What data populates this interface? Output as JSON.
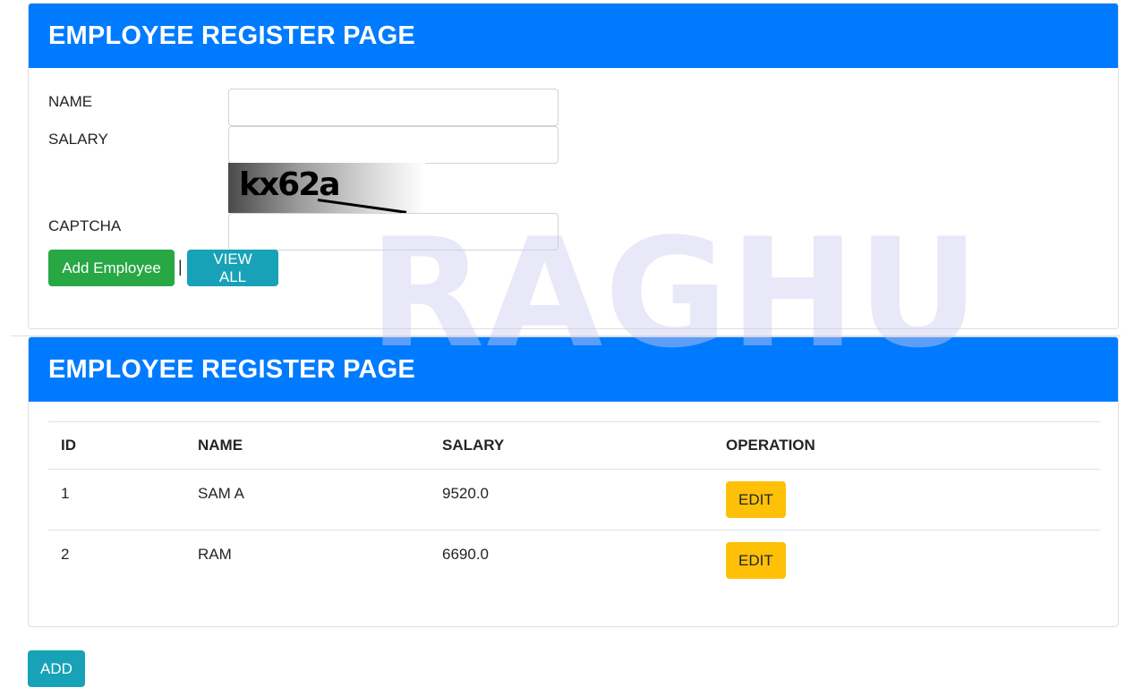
{
  "register_form": {
    "title": "EMPLOYEE REGISTER PAGE",
    "name_label": "NAME",
    "name_value": "",
    "salary_label": "SALARY",
    "salary_value": "",
    "captcha_text": "kx62a",
    "captcha_label": "CAPTCHA",
    "captcha_value": "",
    "add_button": "Add Employee",
    "separator": "|",
    "view_all_button": "VIEW ALL"
  },
  "list": {
    "title": "EMPLOYEE REGISTER PAGE",
    "columns": [
      "ID",
      "NAME",
      "SALARY",
      "OPERATION"
    ],
    "rows": [
      {
        "id": "1",
        "name": "SAM A",
        "salary": "9520.0",
        "action": "EDIT"
      },
      {
        "id": "2",
        "name": "RAM",
        "salary": "6690.0",
        "action": "EDIT"
      }
    ]
  },
  "add_link": "ADD",
  "watermark": "RAGHU",
  "colors": {
    "primary": "#007bff",
    "success": "#28a745",
    "info": "#17a2b8",
    "warning": "#ffc107"
  }
}
